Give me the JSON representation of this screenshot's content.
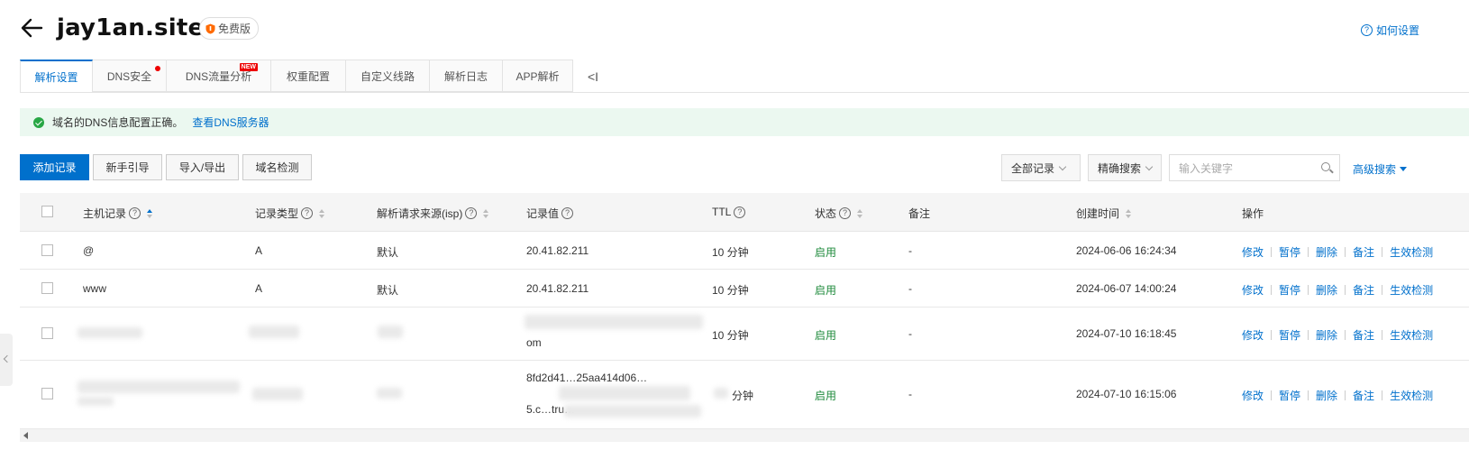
{
  "header": {
    "title": "jay1an.site",
    "edition_badge": "免费版",
    "help_link": "如何设置"
  },
  "tabs": [
    {
      "label": "解析设置",
      "active": true
    },
    {
      "label": "DNS安全",
      "dot": true
    },
    {
      "label": "DNS流量分析",
      "new_badge": "NEW"
    },
    {
      "label": "权重配置"
    },
    {
      "label": "自定义线路"
    },
    {
      "label": "解析日志"
    },
    {
      "label": "APP解析"
    }
  ],
  "tabs_collapse": "<I",
  "notice": {
    "text": "域名的DNS信息配置正确。",
    "link": "查看DNS服务器"
  },
  "toolbar": {
    "add_record": "添加记录",
    "guide": "新手引导",
    "import_export": "导入/导出",
    "domain_check": "域名检测",
    "record_filter": "全部记录",
    "search_mode": "精确搜索",
    "search_placeholder": "输入关键字",
    "advanced_search": "高级搜索"
  },
  "table": {
    "columns": {
      "host": "主机记录",
      "type": "记录类型",
      "isp": "解析请求来源(isp)",
      "value": "记录值",
      "ttl": "TTL",
      "status": "状态",
      "remark": "备注",
      "created": "创建时间",
      "actions": "操作"
    },
    "rows": [
      {
        "host": "@",
        "type": "A",
        "isp": "默认",
        "value": "20.41.82.211",
        "ttl": "10 分钟",
        "status": "启用",
        "remark": "-",
        "created": "2024-06-06 16:24:34"
      },
      {
        "host": "www",
        "type": "A",
        "isp": "默认",
        "value": "20.41.82.211",
        "ttl": "10 分钟",
        "status": "启用",
        "remark": "-",
        "created": "2024-06-07 14:00:24"
      },
      {
        "host": "",
        "type": "",
        "isp": "",
        "value": "om",
        "ttl": "10 分钟",
        "status": "启用",
        "remark": "-",
        "created": "2024-07-10 16:18:45"
      },
      {
        "host": "",
        "type": "",
        "isp": "",
        "value": "8fd2d41…25aa414d06…",
        "value_line2": "5.c…tru…",
        "ttl": "分钟",
        "status": "启用",
        "remark": "-",
        "created": "2024-07-10 16:15:06"
      }
    ],
    "row_actions": [
      "修改",
      "暂停",
      "删除",
      "备注",
      "生效检测"
    ]
  },
  "colors": {
    "accent": "#0070cc",
    "success": "#1e8a3b",
    "notice_bg": "#ebf8f0"
  }
}
